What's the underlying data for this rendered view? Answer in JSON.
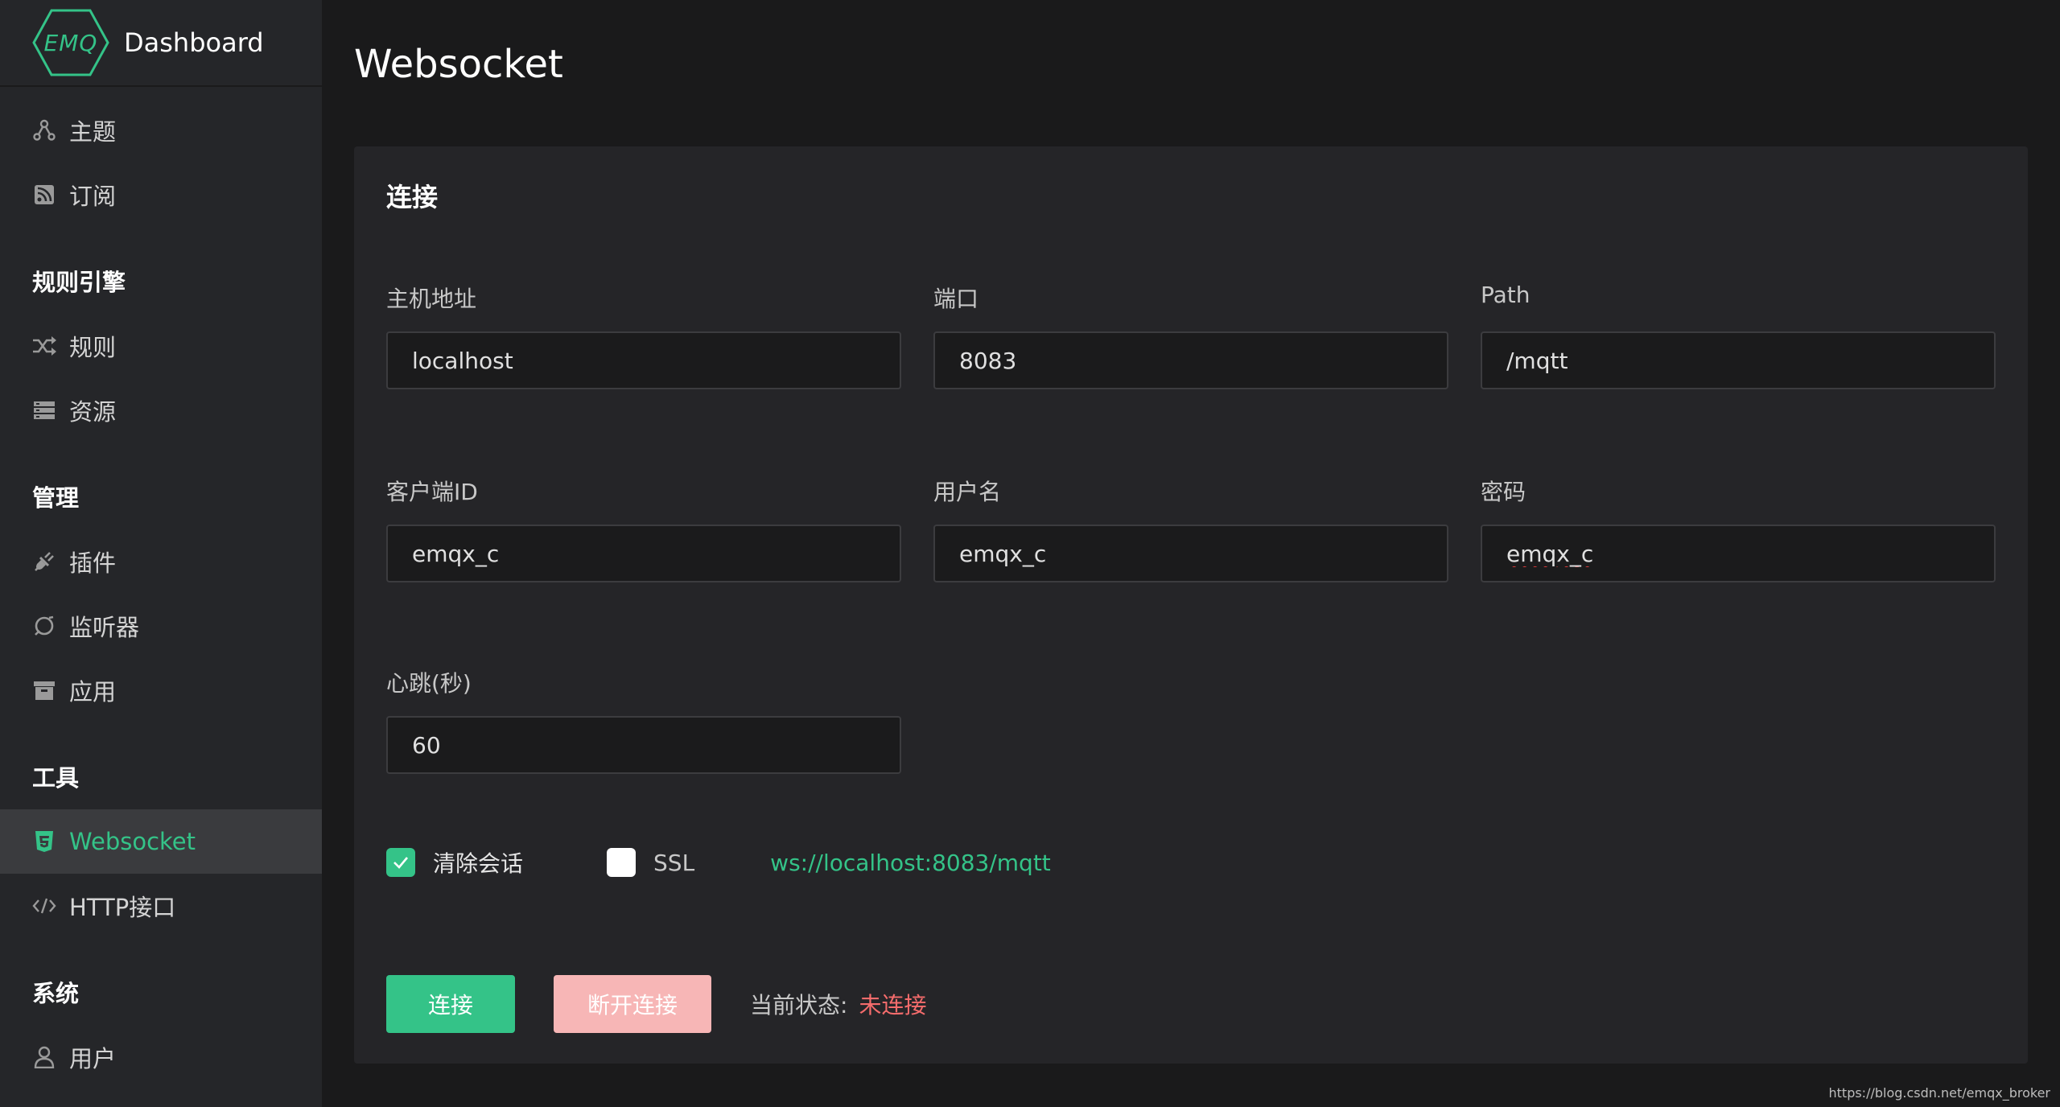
{
  "brand": {
    "logo_text": "EMQ",
    "title": "Dashboard"
  },
  "sidebar": {
    "items_top": [
      {
        "label": "主题",
        "icon": "topic-icon"
      },
      {
        "label": "订阅",
        "icon": "rss-icon"
      }
    ],
    "section_rules": "规则引擎",
    "items_rules": [
      {
        "label": "规则",
        "icon": "shuffle-icon"
      },
      {
        "label": "资源",
        "icon": "storage-icon"
      }
    ],
    "section_manage": "管理",
    "items_manage": [
      {
        "label": "插件",
        "icon": "plug-icon"
      },
      {
        "label": "监听器",
        "icon": "listener-icon"
      },
      {
        "label": "应用",
        "icon": "archive-icon"
      }
    ],
    "section_tools": "工具",
    "items_tools": [
      {
        "label": "Websocket",
        "icon": "html5-icon",
        "active": true
      },
      {
        "label": "HTTP接口",
        "icon": "code-icon"
      }
    ],
    "section_system": "系统",
    "items_system": [
      {
        "label": "用户",
        "icon": "user-icon"
      }
    ]
  },
  "page": {
    "title": "Websocket"
  },
  "connection": {
    "card_title": "连接",
    "host": {
      "label": "主机地址",
      "value": "localhost"
    },
    "port": {
      "label": "端口",
      "value": "8083"
    },
    "path": {
      "label": "Path",
      "value": "/mqtt"
    },
    "client_id": {
      "label": "客户端ID",
      "value": "emqx_c"
    },
    "username": {
      "label": "用户名",
      "value": "emqx_c"
    },
    "password": {
      "label": "密码",
      "value": "emqx_c"
    },
    "keepalive": {
      "label": "心跳(秒)",
      "value": "60"
    },
    "clean_session": {
      "label": "清除会话",
      "checked": true
    },
    "ssl": {
      "label": "SSL",
      "checked": false
    },
    "ws_url": "ws://localhost:8083/mqtt",
    "connect_label": "连接",
    "disconnect_label": "断开连接",
    "status_label": "当前状态:",
    "status_value": "未连接"
  },
  "watermark": "https://blog.csdn.net/emqx_broker",
  "colors": {
    "accent": "#34c388",
    "danger": "#f56c6c",
    "disconnect_bg": "#f7b6b6"
  }
}
